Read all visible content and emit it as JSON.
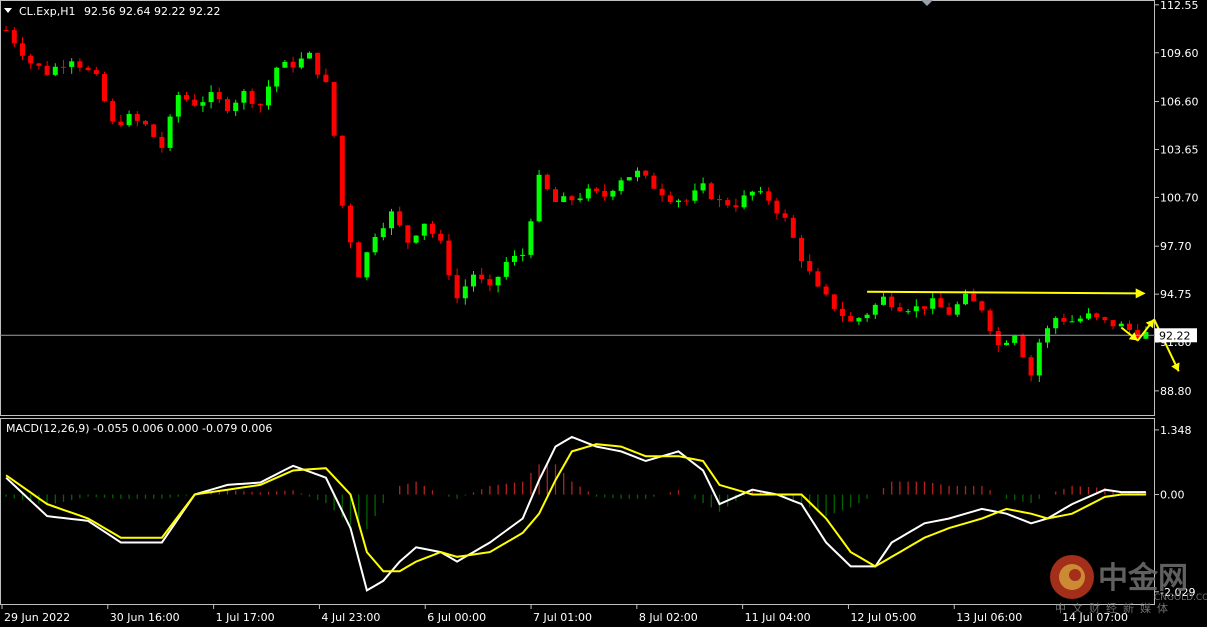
{
  "header": {
    "symbol": "CL.Exp,H1",
    "ohlc": "92.56 92.64 92.22 92.22"
  },
  "macd": {
    "label": "MACD(12,26,9) -0.055 0.006 0.000 -0.079 0.006"
  },
  "price_axis": {
    "ticks": [
      "112.55",
      "109.60",
      "106.60",
      "103.65",
      "100.70",
      "97.70",
      "94.75",
      "91.80",
      "88.80"
    ],
    "current_price": "92.22"
  },
  "macd_axis": {
    "ticks": [
      "1.348",
      "0.00",
      "-2.029"
    ]
  },
  "time_axis": {
    "labels": [
      "29 Jun 2022",
      "30 Jun 16:00",
      "1 Jul 17:00",
      "4 Jul 23:00",
      "6 Jul 00:00",
      "7 Jul 01:00",
      "8 Jul 02:00",
      "11 Jul 04:00",
      "12 Jul 05:00",
      "13 Jul 06:00",
      "14 Jul 07:00"
    ]
  },
  "watermark": {
    "cn": "中金网",
    "en": "CNGOLD.COM",
    "sub": "中文财经新媒体"
  },
  "colors": {
    "background": "#000000",
    "bull_candle": "#00ff00",
    "bear_candle": "#ff0000",
    "macd_line": "#ffffff",
    "signal_line": "#ffff00",
    "hist_pos": "#b22222",
    "hist_neg": "#006400",
    "annotation": "#ffff00",
    "grid": "#c0c0c0"
  },
  "chart_data": {
    "type": "candlestick",
    "timeframe": "H1",
    "ylim": [
      87.5,
      112.6
    ],
    "macd_ylim": [
      -2.2,
      1.45
    ],
    "close_path": [
      [
        0,
        111.0
      ],
      [
        3,
        109.0
      ],
      [
        5,
        108.4
      ],
      [
        8,
        109.3
      ],
      [
        11,
        108.0
      ],
      [
        13,
        105.2
      ],
      [
        15,
        105.6
      ],
      [
        17,
        105.1
      ],
      [
        19,
        103.8
      ],
      [
        21,
        107.0
      ],
      [
        23,
        106.5
      ],
      [
        25,
        106.9
      ],
      [
        27,
        106.3
      ],
      [
        29,
        107.1
      ],
      [
        31,
        106.4
      ],
      [
        33,
        108.7
      ],
      [
        35,
        108.9
      ],
      [
        37,
        109.4
      ],
      [
        39,
        107.6
      ],
      [
        40,
        104.5
      ],
      [
        41,
        100.2
      ],
      [
        43,
        96.0
      ],
      [
        45,
        98.5
      ],
      [
        47,
        99.7
      ],
      [
        49,
        98.0
      ],
      [
        51,
        99.2
      ],
      [
        53,
        97.8
      ],
      [
        55,
        94.5
      ],
      [
        57,
        96.0
      ],
      [
        59,
        95.0
      ],
      [
        61,
        96.7
      ],
      [
        63,
        97.2
      ],
      [
        65,
        101.8
      ],
      [
        67,
        100.4
      ],
      [
        69,
        100.6
      ],
      [
        71,
        101.0
      ],
      [
        73,
        100.8
      ],
      [
        75,
        101.9
      ],
      [
        77,
        102.2
      ],
      [
        79,
        101.4
      ],
      [
        81,
        100.7
      ],
      [
        83,
        100.5
      ],
      [
        85,
        101.3
      ],
      [
        87,
        100.4
      ],
      [
        89,
        100.3
      ],
      [
        91,
        101.0
      ],
      [
        93,
        100.6
      ],
      [
        95,
        99.3
      ],
      [
        97,
        97.0
      ],
      [
        99,
        95.0
      ],
      [
        101,
        94.0
      ],
      [
        103,
        93.0
      ],
      [
        105,
        93.6
      ],
      [
        107,
        94.5
      ],
      [
        109,
        94.0
      ],
      [
        111,
        93.9
      ],
      [
        113,
        94.2
      ],
      [
        115,
        93.6
      ],
      [
        117,
        94.5
      ],
      [
        119,
        93.9
      ],
      [
        121,
        91.6
      ],
      [
        123,
        92.4
      ],
      [
        125,
        89.8
      ],
      [
        126,
        91.8
      ],
      [
        128,
        93.3
      ],
      [
        130,
        93.1
      ],
      [
        132,
        93.4
      ],
      [
        134,
        93.0
      ],
      [
        136,
        92.8
      ],
      [
        138,
        92.3
      ]
    ],
    "annotations": [
      {
        "type": "horizontal-line",
        "from_price": 94.9,
        "to_price": 94.8,
        "arrow": true
      },
      {
        "type": "projection-arrows",
        "path": [
          92.7,
          91.9,
          93.2,
          90.0
        ]
      }
    ],
    "macd_path": [
      [
        0,
        0.35
      ],
      [
        5,
        -0.45
      ],
      [
        10,
        -0.55
      ],
      [
        14,
        -1.0
      ],
      [
        19,
        -1.0
      ],
      [
        23,
        0.0
      ],
      [
        27,
        0.2
      ],
      [
        31,
        0.25
      ],
      [
        35,
        0.6
      ],
      [
        39,
        0.35
      ],
      [
        42,
        -0.7
      ],
      [
        44,
        -2.0
      ],
      [
        46,
        -1.8
      ],
      [
        48,
        -1.4
      ],
      [
        50,
        -1.1
      ],
      [
        53,
        -1.2
      ],
      [
        55,
        -1.4
      ],
      [
        59,
        -1.0
      ],
      [
        63,
        -0.5
      ],
      [
        65,
        0.3
      ],
      [
        67,
        1.0
      ],
      [
        69,
        1.2
      ],
      [
        72,
        1.0
      ],
      [
        75,
        0.9
      ],
      [
        78,
        0.7
      ],
      [
        82,
        0.9
      ],
      [
        85,
        0.5
      ],
      [
        87,
        -0.2
      ],
      [
        91,
        0.1
      ],
      [
        94,
        0.0
      ],
      [
        97,
        -0.2
      ],
      [
        100,
        -1.0
      ],
      [
        103,
        -1.5
      ],
      [
        106,
        -1.5
      ],
      [
        108,
        -1.0
      ],
      [
        112,
        -0.6
      ],
      [
        115,
        -0.5
      ],
      [
        119,
        -0.3
      ],
      [
        122,
        -0.4
      ],
      [
        125,
        -0.6
      ],
      [
        127,
        -0.5
      ],
      [
        130,
        -0.2
      ],
      [
        134,
        0.1
      ],
      [
        136,
        0.05
      ]
    ],
    "signal_path": [
      [
        0,
        0.4
      ],
      [
        5,
        -0.2
      ],
      [
        10,
        -0.5
      ],
      [
        14,
        -0.9
      ],
      [
        19,
        -0.9
      ],
      [
        23,
        0.0
      ],
      [
        27,
        0.1
      ],
      [
        31,
        0.2
      ],
      [
        35,
        0.5
      ],
      [
        39,
        0.55
      ],
      [
        42,
        0.0
      ],
      [
        44,
        -1.2
      ],
      [
        46,
        -1.6
      ],
      [
        48,
        -1.6
      ],
      [
        50,
        -1.4
      ],
      [
        53,
        -1.2
      ],
      [
        55,
        -1.3
      ],
      [
        59,
        -1.2
      ],
      [
        63,
        -0.8
      ],
      [
        65,
        -0.4
      ],
      [
        67,
        0.3
      ],
      [
        69,
        0.9
      ],
      [
        72,
        1.05
      ],
      [
        75,
        1.0
      ],
      [
        78,
        0.8
      ],
      [
        82,
        0.8
      ],
      [
        85,
        0.7
      ],
      [
        87,
        0.2
      ],
      [
        91,
        0.0
      ],
      [
        94,
        0.0
      ],
      [
        97,
        0.0
      ],
      [
        100,
        -0.5
      ],
      [
        103,
        -1.2
      ],
      [
        106,
        -1.5
      ],
      [
        108,
        -1.3
      ],
      [
        112,
        -0.9
      ],
      [
        115,
        -0.7
      ],
      [
        119,
        -0.5
      ],
      [
        122,
        -0.3
      ],
      [
        125,
        -0.4
      ],
      [
        127,
        -0.5
      ],
      [
        130,
        -0.4
      ],
      [
        134,
        -0.05
      ],
      [
        136,
        0.0
      ]
    ]
  }
}
